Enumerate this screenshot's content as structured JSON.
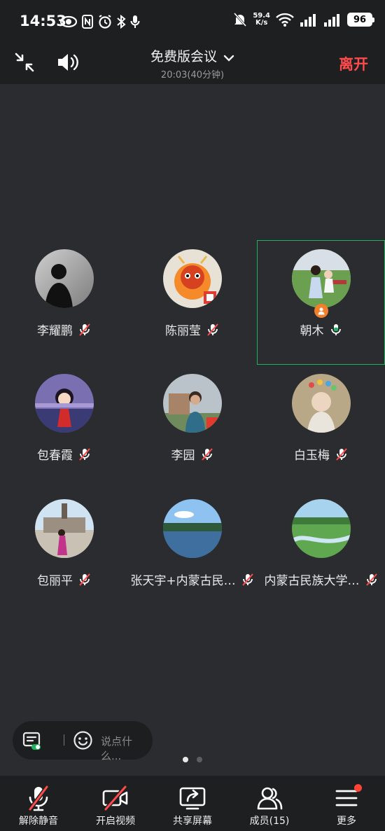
{
  "status_bar": {
    "time": "14:53",
    "net_speed_value": "59.4",
    "net_speed_unit": "K/s",
    "battery": "96"
  },
  "header": {
    "title": "免费版会议",
    "subtitle": "20:03(40分钟)",
    "leave_label": "离开"
  },
  "participants": [
    {
      "name": "李耀鹏",
      "muted": true,
      "avatar": "silhouette-portrait"
    },
    {
      "name": "陈丽莹",
      "muted": true,
      "avatar": "monkey-king-cartoon"
    },
    {
      "name": "朝木",
      "muted": false,
      "host": true,
      "active": true,
      "avatar": "family-photo"
    },
    {
      "name": "包春霞",
      "muted": true,
      "avatar": "cartoon-girl"
    },
    {
      "name": "李园",
      "muted": true,
      "avatar": "man-portrait"
    },
    {
      "name": "白玉梅",
      "muted": true,
      "avatar": "baby-photo"
    },
    {
      "name": "包丽平",
      "muted": true,
      "avatar": "woman-at-monument"
    },
    {
      "name": "张天宇+内蒙古民…",
      "muted": true,
      "avatar": "lake-landscape"
    },
    {
      "name": "内蒙古民族大学…",
      "muted": true,
      "avatar": "grassland-river"
    }
  ],
  "chat": {
    "placeholder": "说点什么..."
  },
  "pager": {
    "current": 1,
    "total": 2
  },
  "bottom_bar": {
    "unmute_label": "解除静音",
    "video_label": "开启视频",
    "share_label": "共享屏幕",
    "members_label": "成员(15)",
    "more_label": "更多"
  },
  "colors": {
    "accent_green": "#1fb35b",
    "leave_red": "#ff4b4b",
    "badge_red": "#ff4436",
    "host_orange": "#f17f2b"
  }
}
